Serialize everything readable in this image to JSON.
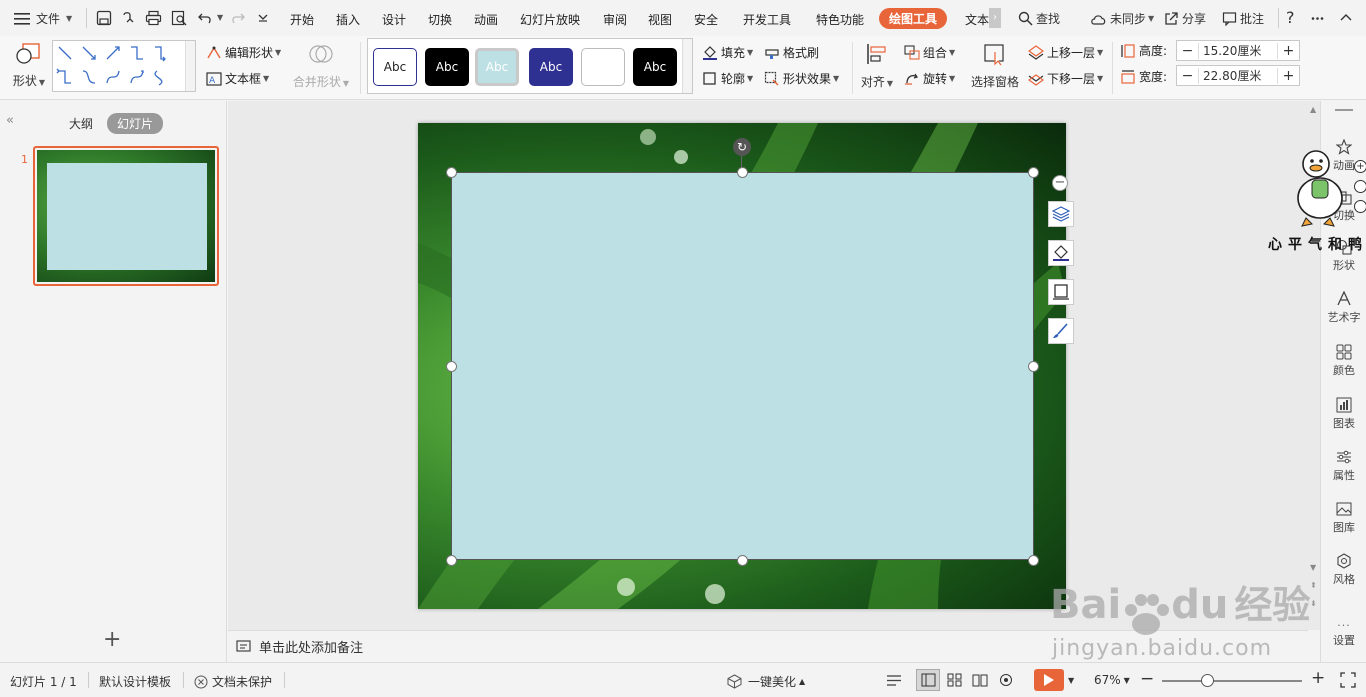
{
  "menubar": {
    "file_label": "文件",
    "tabs": [
      "开始",
      "插入",
      "设计",
      "切换",
      "动画",
      "幻灯片放映",
      "审阅",
      "视图",
      "安全",
      "开发工具",
      "特色功能",
      "绘图工具",
      "文本"
    ],
    "active_tab": "绘图工具",
    "search_label": "查找",
    "sync_label": "未同步",
    "share_label": "分享",
    "comment_label": "批注",
    "help_label": "?"
  },
  "ribbon": {
    "shape_label": "形状",
    "edit_shape_label": "编辑形状",
    "textbox_label": "文本框",
    "merge_shape_label": "合并形状",
    "style_samples": [
      "Abc",
      "Abc",
      "Abc",
      "Abc",
      "",
      "Abc"
    ],
    "fill_label": "填充",
    "outline_label": "轮廓",
    "format_brush_label": "格式刷",
    "shape_effect_label": "形状效果",
    "align_label": "对齐",
    "group_label": "组合",
    "rotate_label": "旋转",
    "selection_pane_label": "选择窗格",
    "bring_forward_label": "上移一层",
    "send_backward_label": "下移一层",
    "height_label": "高度:",
    "height_value": "15.20厘米",
    "width_label": "宽度:",
    "width_value": "22.80厘米"
  },
  "leftpanel": {
    "outline_tab": "大纲",
    "slides_tab": "幻灯片",
    "slide_number": "1",
    "add_label": "+"
  },
  "notes": {
    "placeholder": "单击此处添加备注"
  },
  "rightpanel": {
    "items": [
      "动画",
      "切换",
      "形状",
      "艺术字",
      "颜色",
      "图表",
      "属性",
      "图库",
      "风格",
      "设置"
    ]
  },
  "watermark": {
    "duck_caption": "心平气和鸭",
    "baidu_brand": "Bai",
    "baidu_brand2": "du",
    "baidu_cn": "经验",
    "baidu_url": "jingyan.baidu.com"
  },
  "statusbar": {
    "slide_info": "幻灯片 1 / 1",
    "template_label": "默认设计模板",
    "protect_label": "文档未保护",
    "beautify_label": "一键美化",
    "zoom_label": "67%"
  },
  "colors": {
    "accent": "#e8653a",
    "shape_fill": "#bce0e4",
    "dark_blue": "#2e3192"
  }
}
